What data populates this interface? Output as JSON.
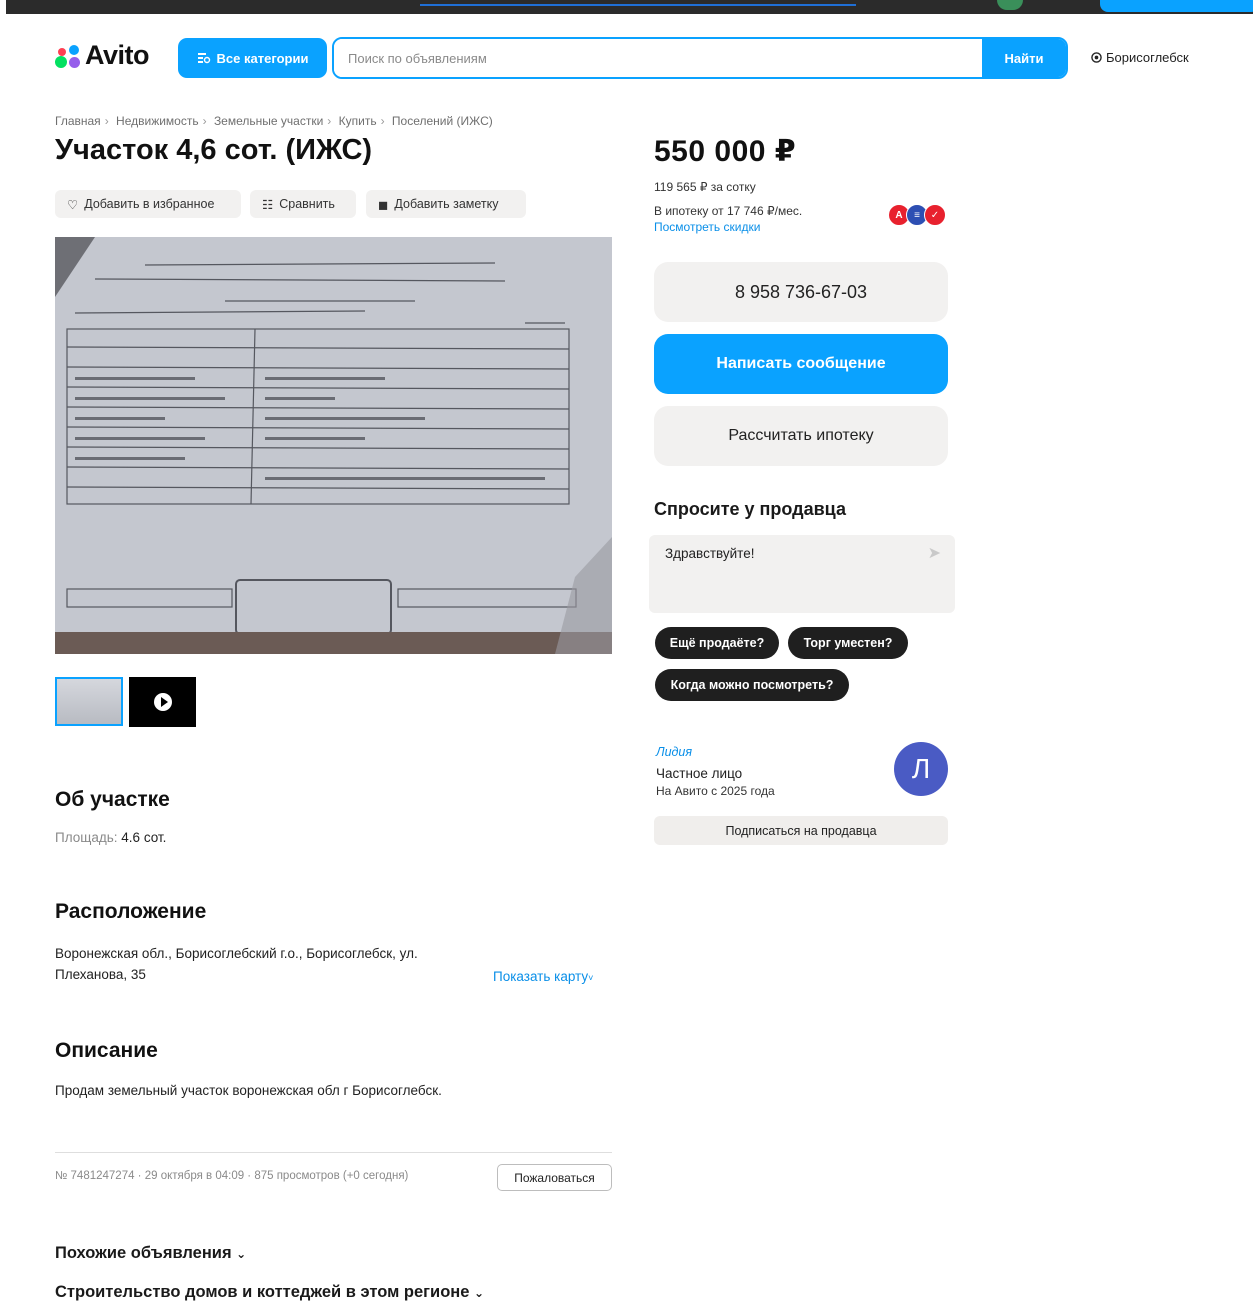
{
  "brand": {
    "name": "Avito"
  },
  "header": {
    "categories_label": "Все категории",
    "search_placeholder": "Поиск по объявлениям",
    "search_button": "Найти",
    "city": "Борисоглебск"
  },
  "breadcrumbs": [
    "Главная",
    "Недвижимость",
    "Земельные участки",
    "Купить",
    "Поселений (ИЖС)"
  ],
  "listing": {
    "title": "Участок 4,6 сот. (ИЖС)",
    "actions": {
      "favorite": "Добавить в избранное",
      "compare": "Сравнить",
      "note": "Добавить заметку"
    },
    "about": {
      "heading": "Об участке",
      "area_label": "Площадь:",
      "area_value": "4.6 сот."
    },
    "location": {
      "heading": "Расположение",
      "address_line1": "Воронежская обл., Борисоглебский г.о., Борисоглебск, ул.",
      "address_line2": "Плеханова, 35",
      "show_map": "Показать карту"
    },
    "description": {
      "heading": "Описание",
      "text": "Продам земельный участок воронежская обл г Борисоглебск."
    },
    "meta": "№ 7481247274 · 29 октября в 04:09 · 875 просмотров (+0 сегодня)",
    "report": "Пожаловаться",
    "similar": "Похожие объявления",
    "construction": "Строительство домов и коттеджей в этом регионе"
  },
  "sidebar": {
    "price": "550 000 ₽",
    "price_per": "119 565 ₽ за сотку",
    "mortgage": "В ипотеку от 17 746 ₽/мес.",
    "discounts_link": "Посмотреть скидки",
    "phone": "8 958 736-67-03",
    "message_button": "Написать сообщение",
    "mortgage_button": "Рассчитать ипотеку",
    "ask_heading": "Спросите у продавца",
    "ask_text": "Здравствуйте!",
    "quick_questions": [
      "Ещё продаёте?",
      "Торг уместен?",
      "Когда можно посмотреть?"
    ],
    "seller": {
      "name": "Лидия",
      "type": "Частное лицо",
      "since": "На Авито с 2025 года",
      "avatar_letter": "Л",
      "subscribe": "Подписаться на продавца"
    }
  },
  "colors": {
    "accent": "#0aa2ff",
    "chip_bg": "#1f1f1f",
    "avatar_bg": "#4a5bc4",
    "link": "#0a8fe8"
  }
}
